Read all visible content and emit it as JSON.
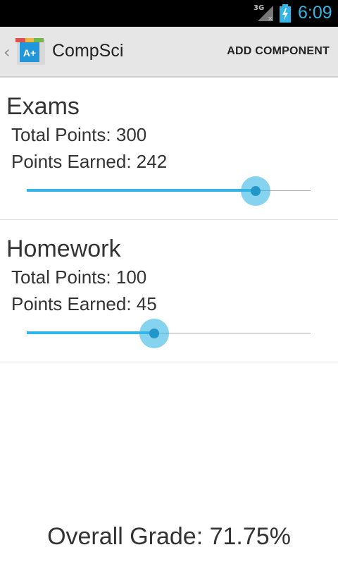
{
  "status_bar": {
    "network": "3G",
    "time": "6:09",
    "icons": [
      "signal-icon",
      "battery-charging-icon"
    ]
  },
  "action_bar": {
    "title": "CompSci",
    "app_icon_text": "A+",
    "action_label": "ADD COMPONENT"
  },
  "components": [
    {
      "name": "Exams",
      "total_text": "Total Points: 300",
      "earned_text": "Points Earned: 242",
      "total": 300,
      "earned": 242
    },
    {
      "name": "Homework",
      "total_text": "Total Points: 100",
      "earned_text": "Points Earned: 45",
      "total": 100,
      "earned": 45
    }
  ],
  "overall_grade": "Overall Grade: 71.75%",
  "colors": {
    "accent": "#33b5e5",
    "thumb": "#2196c9",
    "action_bar_bg": "#e6e6e6"
  }
}
